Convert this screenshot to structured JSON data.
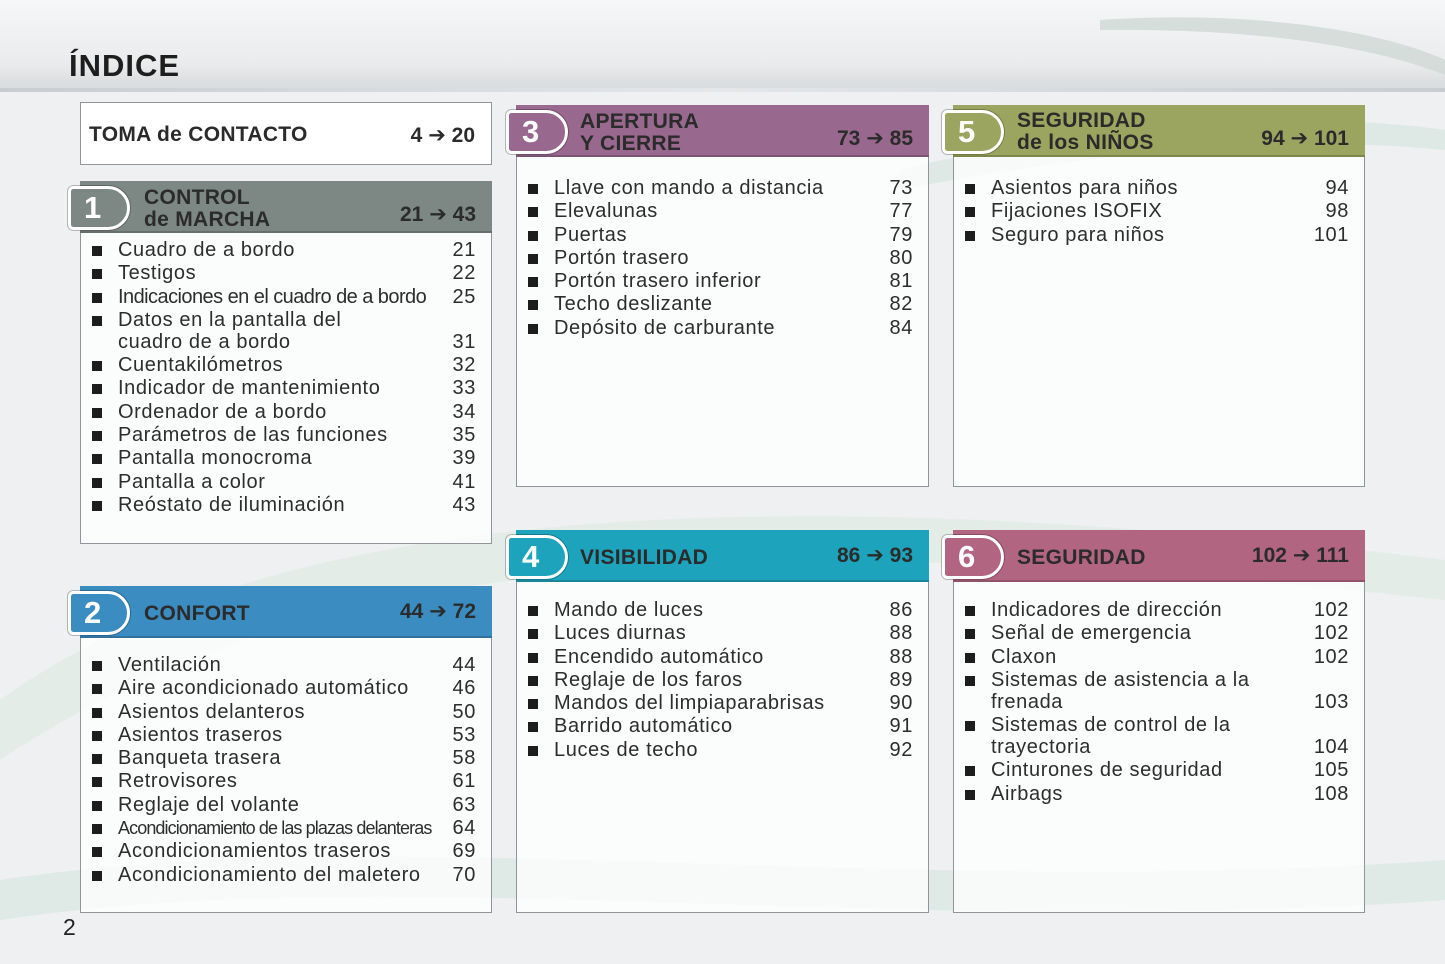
{
  "page": {
    "title": "ÍNDICE",
    "number": "2"
  },
  "arrow": "➔",
  "toma": {
    "label": "TOMA de CONTACTO",
    "from": "4",
    "to": "20"
  },
  "sections": [
    {
      "number": "1",
      "title_lines": [
        "CONTROL",
        "de MARCHA"
      ],
      "from": "21",
      "to": "43",
      "color": "#7d8884",
      "entries": [
        {
          "text": "Cuadro de a bordo",
          "page": "21"
        },
        {
          "text": "Testigos",
          "page": "22"
        },
        {
          "text": "Indicaciones en el cuadro de a bordo",
          "page": "25"
        },
        {
          "text": "Datos en la pantalla del cuadro de a bordo",
          "page": "31"
        },
        {
          "text": "Cuentakilómetros",
          "page": "32"
        },
        {
          "text": "Indicador de mantenimiento",
          "page": "33"
        },
        {
          "text": "Ordenador de a bordo",
          "page": "34"
        },
        {
          "text": "Parámetros de las funciones",
          "page": "35"
        },
        {
          "text": "Pantalla monocroma",
          "page": "39"
        },
        {
          "text": "Pantalla a color",
          "page": "41"
        },
        {
          "text": "Reóstato de iluminación",
          "page": "43"
        }
      ]
    },
    {
      "number": "2",
      "title_lines": [
        "CONFORT"
      ],
      "from": "44",
      "to": "72",
      "color": "#3b8cc0",
      "entries": [
        {
          "text": "Ventilación",
          "page": "44"
        },
        {
          "text": "Aire acondicionado automático",
          "page": "46"
        },
        {
          "text": "Asientos delanteros",
          "page": "50"
        },
        {
          "text": "Asientos traseros",
          "page": "53"
        },
        {
          "text": "Banqueta trasera",
          "page": "58"
        },
        {
          "text": "Retrovisores",
          "page": "61"
        },
        {
          "text": "Reglaje del volante",
          "page": "63"
        },
        {
          "text": "Acondicionamiento de las plazas delanteras",
          "page": "64"
        },
        {
          "text": "Acondicionamientos traseros",
          "page": "69"
        },
        {
          "text": "Acondicionamiento del maletero",
          "page": "70"
        }
      ]
    },
    {
      "number": "3",
      "title_lines": [
        "APERTURA",
        "Y CIERRE"
      ],
      "from": "73",
      "to": "85",
      "color": "#99688e",
      "entries": [
        {
          "text": "Llave con mando a distancia",
          "page": "73"
        },
        {
          "text": "Elevalunas",
          "page": "77"
        },
        {
          "text": "Puertas",
          "page": "79"
        },
        {
          "text": "Portón trasero",
          "page": "80"
        },
        {
          "text": "Portón trasero inferior",
          "page": "81"
        },
        {
          "text": "Techo deslizante",
          "page": "82"
        },
        {
          "text": "Depósito de carburante",
          "page": "84"
        }
      ]
    },
    {
      "number": "4",
      "title_lines": [
        "VISIBILIDAD"
      ],
      "from": "86",
      "to": "93",
      "color": "#1ea3bd",
      "entries": [
        {
          "text": "Mando de luces",
          "page": "86"
        },
        {
          "text": "Luces diurnas",
          "page": "88"
        },
        {
          "text": "Encendido automático",
          "page": "88"
        },
        {
          "text": "Reglaje de los faros",
          "page": "89"
        },
        {
          "text": "Mandos del limpiaparabrisas",
          "page": "90"
        },
        {
          "text": "Barrido automático",
          "page": "91"
        },
        {
          "text": "Luces de techo",
          "page": "92"
        }
      ]
    },
    {
      "number": "5",
      "title_lines": [
        "SEGURIDAD",
        "de los NIÑOS"
      ],
      "from": "94",
      "to": "101",
      "color": "#9ca55f",
      "entries": [
        {
          "text": "Asientos para niños",
          "page": "94"
        },
        {
          "text": "Fijaciones ISOFIX",
          "page": "98"
        },
        {
          "text": "Seguro para niños",
          "page": "101"
        }
      ]
    },
    {
      "number": "6",
      "title_lines": [
        "SEGURIDAD"
      ],
      "from": "102",
      "to": "111",
      "color": "#b26580",
      "entries": [
        {
          "text": "Indicadores de dirección",
          "page": "102"
        },
        {
          "text": "Señal de emergencia",
          "page": "102"
        },
        {
          "text": "Claxon",
          "page": "102"
        },
        {
          "text": "Sistemas de asistencia a la frenada",
          "page": "103"
        },
        {
          "text": "Sistemas de control de la trayectoria",
          "page": "104"
        },
        {
          "text": "Cinturones de seguridad",
          "page": "105"
        },
        {
          "text": "Airbags",
          "page": "108"
        }
      ]
    }
  ]
}
